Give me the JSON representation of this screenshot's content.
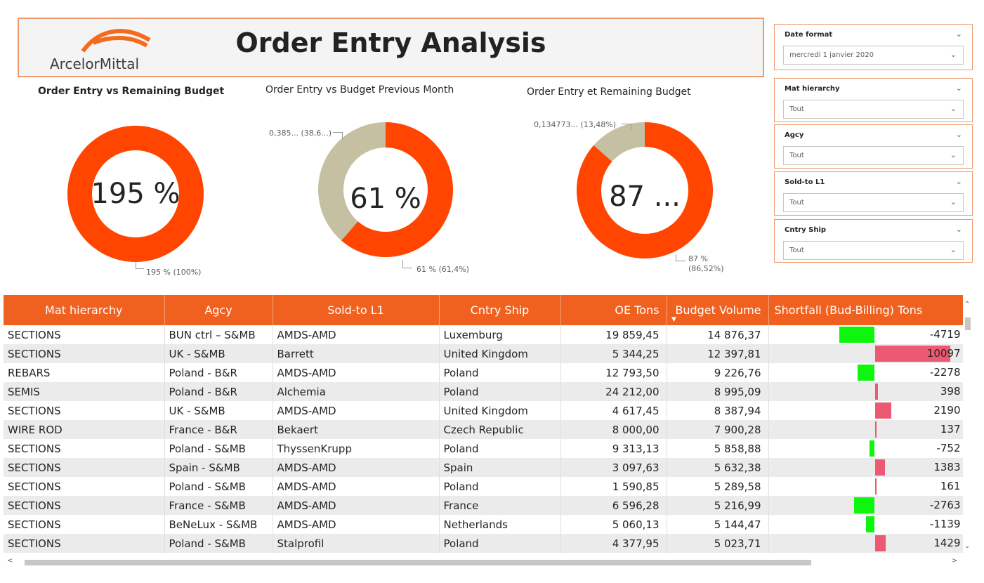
{
  "header": {
    "title": "Order Entry Analysis",
    "logo_text": "ArcelorMittal"
  },
  "charts": {
    "c1": {
      "title": "Order Entry vs Remaining Budget",
      "center": "195 %",
      "label_main": "195 % (100%)"
    },
    "c2": {
      "title": "Order Entry vs Budget Previous Month",
      "center": "61 %",
      "label_main": "61 % (61,4%)",
      "label_other": "0,385... (38,6...)"
    },
    "c3": {
      "title": "Order Entry et Remaining Budget",
      "center": "87 ...",
      "label_main_1": "87 %",
      "label_main_2": "(86,52%)",
      "label_other": "0,134773... (13,48%)"
    }
  },
  "chart_data": [
    {
      "type": "pie",
      "title": "Order Entry vs Remaining Budget",
      "slices": [
        {
          "value": 100,
          "color": "#ff4500"
        }
      ]
    },
    {
      "type": "pie",
      "title": "Order Entry vs Budget Previous Month",
      "slices": [
        {
          "value": 61.4,
          "color": "#ff4500"
        },
        {
          "value": 38.6,
          "color": "#c4c0a1"
        }
      ]
    },
    {
      "type": "pie",
      "title": "Order Entry et Remaining Budget",
      "slices": [
        {
          "value": 86.52,
          "color": "#ff4500"
        },
        {
          "value": 13.48,
          "color": "#c4c0a1"
        }
      ]
    }
  ],
  "slicers": [
    {
      "title": "Date format",
      "value": "mercredi 1 janvier 2020"
    },
    {
      "title": "Mat hierarchy",
      "value": "Tout"
    },
    {
      "title": "Agcy",
      "value": "Tout"
    },
    {
      "title": "Sold-to L1",
      "value": "Tout"
    },
    {
      "title": "Cntry Ship",
      "value": "Tout"
    }
  ],
  "table": {
    "columns": [
      "Mat hierarchy",
      "Agcy",
      "Sold-to L1",
      "Cntry Ship",
      "OE Tons",
      "Budget Volume",
      "Shortfall (Bud-Billing) Tons"
    ],
    "rows": [
      [
        "SECTIONS",
        "BUN ctrl – S&MB",
        "AMDS-AMD",
        "Luxemburg",
        "19 859,45",
        "14 876,37",
        "-4719"
      ],
      [
        "SECTIONS",
        "UK - S&MB",
        "Barrett",
        "United Kingdom",
        "5 344,25",
        "12 397,81",
        "10097"
      ],
      [
        "REBARS",
        "Poland - B&R",
        "AMDS-AMD",
        "Poland",
        "12 793,50",
        "9 226,76",
        "-2278"
      ],
      [
        "SEMIS",
        "Poland - B&R",
        "Alchemia",
        "Poland",
        "24 212,00",
        "8 995,09",
        "398"
      ],
      [
        "SECTIONS",
        "UK - S&MB",
        "AMDS-AMD",
        "United Kingdom",
        "4 617,45",
        "8 387,94",
        "2190"
      ],
      [
        "WIRE ROD",
        "France - B&R",
        "Bekaert",
        "Czech Republic",
        "8 000,00",
        "7 900,28",
        "137"
      ],
      [
        "SECTIONS",
        "Poland - S&MB",
        "ThyssenKrupp",
        "Poland",
        "9 313,13",
        "5 858,88",
        "-752"
      ],
      [
        "SECTIONS",
        "Spain - S&MB",
        "AMDS-AMD",
        "Spain",
        "3 097,63",
        "5 632,38",
        "1383"
      ],
      [
        "SECTIONS",
        "Poland - S&MB",
        "AMDS-AMD",
        "Poland",
        "1 590,85",
        "5 289,58",
        "161"
      ],
      [
        "SECTIONS",
        "France - S&MB",
        "AMDS-AMD",
        "France",
        "6 596,28",
        "5 216,99",
        "-2763"
      ],
      [
        "SECTIONS",
        "BeNeLux - S&MB",
        "AMDS-AMD",
        "Netherlands",
        "5 060,13",
        "5 144,47",
        "-1139"
      ],
      [
        "SECTIONS",
        "Poland - S&MB",
        "Stalprofil",
        "Poland",
        "4 377,95",
        "5 023,71",
        "1429"
      ]
    ],
    "shortfall_values": [
      -4719,
      10097,
      -2278,
      398,
      2190,
      137,
      -752,
      1383,
      161,
      -2763,
      -1139,
      1429
    ],
    "colors": {
      "header_bg": "#f0611f",
      "positive_bar": "#eb5a72",
      "negative_bar": "#0ef50e"
    }
  }
}
